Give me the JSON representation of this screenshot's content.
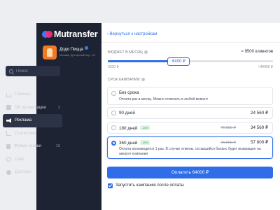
{
  "app": {
    "name": "Mutransfer"
  },
  "org": {
    "name": "Додо Пицца",
    "address": "Москва, Дегтярный пер., 21"
  },
  "search": {
    "placeholder": "Поиск"
  },
  "nav": {
    "items": [
      {
        "label": "Главная",
        "icon": "home-icon",
        "count": ""
      },
      {
        "label": "Об организации",
        "icon": "building-icon",
        "count": "2"
      },
      {
        "label": "Реклама",
        "icon": "megaphone-icon",
        "count": "",
        "active": true
      },
      {
        "label": "Статистика",
        "icon": "chart-icon",
        "count": ""
      },
      {
        "label": "Форма заявки",
        "icon": "form-icon",
        "count": "16"
      },
      {
        "label": "Сайт",
        "icon": "globe-icon",
        "count": ""
      },
      {
        "label": "Доступы",
        "icon": "gear-icon",
        "count": ""
      }
    ]
  },
  "main": {
    "back_label": "Вернуться к настройкам",
    "budget": {
      "label": "БЮДЖЕТ В МЕСЯЦ",
      "reach": "≈ 9500 клиентов",
      "min": "3200 ₽",
      "max": "≈40000 ₽",
      "value": "6400 ₽",
      "fraction": 0.43
    },
    "term": {
      "label": "СРОК КАМПАНИИ",
      "options": [
        {
          "title": "Без срока",
          "subtitle": "Оплата раз в месяц. Можно отменить в любой момент",
          "price": "",
          "old_price": "",
          "badge": ""
        },
        {
          "title": "90 дней",
          "subtitle": "",
          "price": "24 560 ₽",
          "old_price": "",
          "badge": ""
        },
        {
          "title": "180 дней",
          "subtitle": "",
          "price": "34 560 ₽",
          "old_price": "76 800 ₽",
          "badge": "-10%"
        },
        {
          "title": "360 дней",
          "subtitle": "Оплата производится 1 раз. В случае отмены, оставшийся баланс будет возвращен на аккаунт компании",
          "price": "57 600 ₽",
          "old_price": "76 800 ₽",
          "badge": "-25%",
          "selected": true
        }
      ]
    },
    "pay_label": "Оплатить 64000 ₽",
    "start_after_payment_label": "Запустить кампанию после оплаты",
    "start_after_payment_checked": true
  },
  "colors": {
    "accent": "#2f6ee8",
    "sidebar": "#1e2333",
    "brand_pink": "#ff2f7a"
  }
}
